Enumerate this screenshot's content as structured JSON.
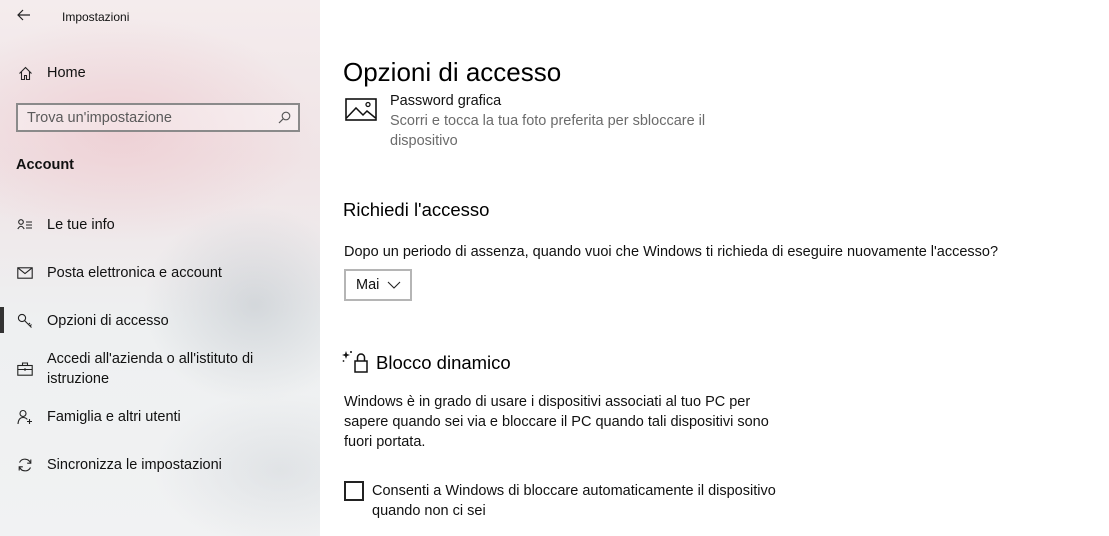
{
  "app": {
    "title": "Impostazioni"
  },
  "sidebar": {
    "home_label": "Home",
    "search": {
      "placeholder": "Trova un'impostazione"
    },
    "section_title": "Account",
    "items": [
      {
        "label": "Le tue info",
        "icon": "person-card-icon"
      },
      {
        "label": "Posta elettronica e account",
        "icon": "mail-icon"
      },
      {
        "label": "Opzioni di accesso",
        "icon": "key-icon",
        "selected": true
      },
      {
        "label": "Accedi all'azienda o all'istituto di istruzione",
        "icon": "briefcase-icon"
      },
      {
        "label": "Famiglia e altri utenti",
        "icon": "person-add-icon"
      },
      {
        "label": "Sincronizza le impostazioni",
        "icon": "sync-icon"
      }
    ]
  },
  "main": {
    "title": "Opzioni di accesso",
    "picture_password": {
      "title": "Password grafica",
      "description": "Scorri e tocca la tua foto preferita per sbloccare il dispositivo"
    },
    "require_signin": {
      "heading": "Richiedi l'accesso",
      "question": "Dopo un periodo di assenza, quando vuoi che Windows ti richieda di eseguire nuovamente l'accesso?",
      "dropdown_value": "Mai"
    },
    "dynamic_lock": {
      "heading": "Blocco dinamico",
      "description": "Windows è in grado di usare i dispositivi associati al tuo PC per sapere quando sei via e bloccare il PC quando tali dispositivi sono fuori portata.",
      "checkbox_label": "Consenti a Windows di bloccare automaticamente il dispositivo quando non ci sei",
      "checkbox_checked": false
    }
  },
  "colors": {
    "sidebar_pink": "#f0e4e6",
    "selected_indicator": "#333333",
    "secondary_text": "#6b6b6b"
  }
}
